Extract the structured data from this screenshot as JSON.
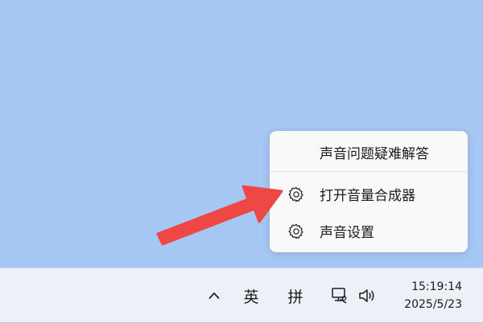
{
  "context_menu": {
    "items": [
      {
        "label": "声音问题疑难解答",
        "icon": ""
      },
      {
        "label": "打开音量合成器",
        "icon": "gear-icon"
      },
      {
        "label": "声音设置",
        "icon": "gear-icon"
      }
    ]
  },
  "taskbar": {
    "show_hidden_icon": "chevron-up-icon",
    "ime_mode": "英",
    "ime_method": "拼",
    "network_icon": "network-icon",
    "volume_icon": "speaker-icon",
    "clock": {
      "time": "15:19:14",
      "date": "2025/5/23"
    }
  },
  "colors": {
    "desktop": "#a6c6f3",
    "menu_background": "#f9f9f9",
    "taskbar": "#edf0f6",
    "annotation_arrow": "#ef4646"
  }
}
